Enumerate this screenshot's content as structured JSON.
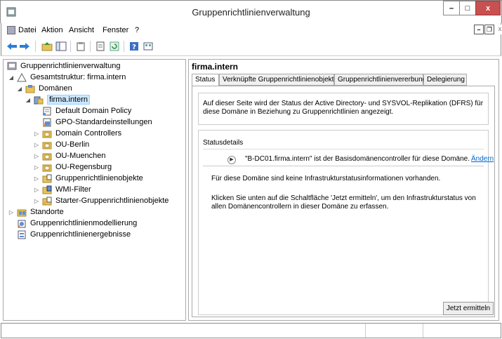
{
  "window": {
    "title": "Gruppenrichtlinienverwaltung",
    "min_glyph": "–",
    "max_glyph": "□",
    "close_glyph": "x"
  },
  "menu": {
    "items": [
      "Datei",
      "Aktion",
      "Ansicht",
      "Fenster",
      "?"
    ],
    "mdi_min": "–",
    "mdi_restore": "̥",
    "mdi_close": "x"
  },
  "tree": {
    "nodes": [
      {
        "label": "Gruppenrichtlinienverwaltung",
        "icon": "console-icon"
      },
      {
        "label": "Gesamtstruktur: firma.intern",
        "icon": "forest-icon"
      },
      {
        "label": "Domänen",
        "icon": "domains-icon"
      },
      {
        "label": "firma.intern",
        "icon": "domain-icon"
      },
      {
        "label": "Default Domain Policy",
        "icon": "gpo-link-icon"
      },
      {
        "label": "GPO-Standardeinstellungen",
        "icon": "gpo-defaults-icon"
      },
      {
        "label": "Domain Controllers",
        "icon": "ou-icon"
      },
      {
        "label": "OU-Berlin",
        "icon": "ou-icon"
      },
      {
        "label": "OU-Muenchen",
        "icon": "ou-icon"
      },
      {
        "label": "OU-Regensburg",
        "icon": "ou-icon"
      },
      {
        "label": "Gruppenrichtlinienobjekte",
        "icon": "gpo-folder-icon"
      },
      {
        "label": "WMI-Filter",
        "icon": "wmi-folder-icon"
      },
      {
        "label": "Starter-Gruppenrichtlinienobjekte",
        "icon": "starter-gpo-folder-icon"
      },
      {
        "label": "Standorte",
        "icon": "sites-icon"
      },
      {
        "label": "Gruppenrichtlinienmodellierung",
        "icon": "modeling-icon"
      },
      {
        "label": "Gruppenrichtlinienergebnisse",
        "icon": "results-icon"
      }
    ]
  },
  "right": {
    "title": "firma.intern",
    "tabs": [
      "Status",
      "Verknüpfte Gruppenrichtlinienobjekte",
      "Gruppenrichtlinienvererbung",
      "Delegierung"
    ],
    "info": "Auf dieser Seite wird der Status der Active Directory- und SYSVOL-Replikation (DFRS) für diese Domäne in Beziehung zu Gruppenrichtlinien angezeigt.",
    "status_header": "Statusdetails",
    "dc_text": "\"B-DC01.firma.intern\" ist der Basisdomänencontroller für diese Domäne.",
    "dc_link": "Ändern",
    "note1": "Für diese Domäne sind keine Infrastrukturstatusinformationen vorhanden.",
    "note2": "Klicken Sie unten auf die Schaltfläche 'Jetzt ermitteln', um den Infrastrukturstatus von allen Domänencontrollern in dieser Domäne zu erfassen.",
    "button": "Jetzt ermitteln"
  },
  "colors": {
    "close_red": "#c75050",
    "selection": "#cce8ff",
    "link": "#0066cc"
  }
}
